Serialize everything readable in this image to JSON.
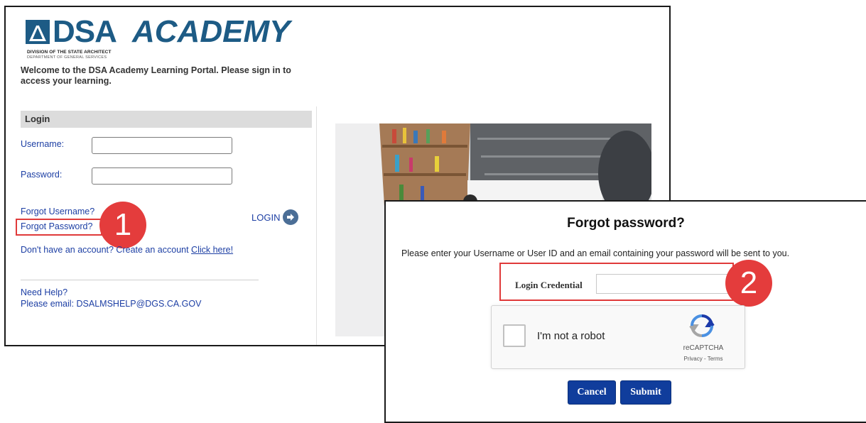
{
  "login_window": {
    "logo": {
      "brand_dsa": "DSA",
      "brand_academy": "ACADEMY",
      "subtitle_1": "DIVISION OF THE STATE ARCHITECT",
      "subtitle_2": "DEPARTMENT OF GENERAL SERVICES"
    },
    "welcome_text": "Welcome to the DSA Academy Learning Portal. Please sign in to access your learning.",
    "panel_title": "Login",
    "username_label": "Username:",
    "password_label": "Password:",
    "username_value": "",
    "password_value": "",
    "forgot_username": "Forgot Username?",
    "forgot_password": "Forgot Password?",
    "login_button": "LOGIN",
    "no_account_text": "Don't have an account? Create an account ",
    "click_here": "Click here!",
    "need_help": "Need Help?",
    "help_email": "Please email: DSALMSHELP@DGS.CA.GOV"
  },
  "badges": {
    "step_1": "1",
    "step_2": "2"
  },
  "forgot_dialog": {
    "title": "Forgot password?",
    "instructions": "Please enter your Username or User ID and an email containing your password will be sent to you.",
    "credential_label": "Login Credential",
    "credential_value": "",
    "captcha_label": "I'm not a robot",
    "captcha_brand": "reCAPTCHA",
    "captcha_terms": "Privacy - Terms",
    "cancel_button": "Cancel",
    "submit_button": "Submit"
  },
  "colors": {
    "brand_blue": "#1d5b85",
    "link_blue": "#1d3fa4",
    "highlight_red": "#e03a3a",
    "button_blue": "#103d9c"
  },
  "icons": {
    "login_arrow": "arrow-right-circle-icon",
    "logo_mark": "compass-triangle-icon",
    "captcha": "recaptcha-icon"
  }
}
